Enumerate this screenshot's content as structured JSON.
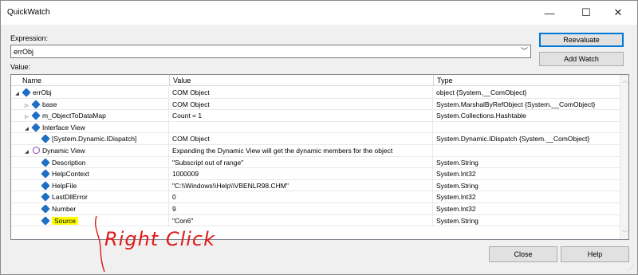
{
  "window": {
    "title": "QuickWatch",
    "minimize": "—",
    "maximize": "☐",
    "close": "✕"
  },
  "expression": {
    "label": "Expression:",
    "value": "errObj"
  },
  "value_label": "Value:",
  "buttons": {
    "reevaluate": "Reevaluate",
    "add_watch": "Add Watch",
    "close": "Close",
    "help": "Help"
  },
  "grid": {
    "columns": [
      "Name",
      "Value",
      "Type"
    ],
    "rows": [
      {
        "indent": 0,
        "expander": "◢",
        "icon": "object",
        "name": "errObj",
        "value": "COM Object",
        "type": "object {System.__ComObject}",
        "highlight": false
      },
      {
        "indent": 1,
        "expander": "▷",
        "icon": "object",
        "name": "base",
        "value": "COM Object",
        "type": "System.MarshalByRefObject {System.__ComObject}",
        "highlight": false
      },
      {
        "indent": 1,
        "expander": "▷",
        "icon": "object-private",
        "name": "m_ObjectToDataMap",
        "value": "Count = 1",
        "type": "System.Collections.Hashtable",
        "highlight": false
      },
      {
        "indent": 1,
        "expander": "◢",
        "icon": "object",
        "name": "Interface View",
        "value": "",
        "type": "",
        "highlight": false
      },
      {
        "indent": 2,
        "expander": "",
        "icon": "object",
        "name": "[System.Dynamic.IDispatch]",
        "value": "COM Object",
        "type": "System.Dynamic.IDispatch {System.__ComObject}",
        "highlight": false
      },
      {
        "indent": 1,
        "expander": "◢",
        "icon": "dynamic",
        "name": "Dynamic View",
        "value": "Expanding the Dynamic View will get the dynamic members for the object",
        "type": "",
        "highlight": false
      },
      {
        "indent": 2,
        "expander": "",
        "icon": "object",
        "name": "Description",
        "value": "\"Subscript out of range\"",
        "type": "System.String",
        "highlight": false
      },
      {
        "indent": 2,
        "expander": "",
        "icon": "object",
        "name": "HelpContext",
        "value": "1000009",
        "type": "System.Int32",
        "highlight": false
      },
      {
        "indent": 2,
        "expander": "",
        "icon": "object",
        "name": "HelpFile",
        "value": "\"C:\\\\Windows\\\\Help\\\\VBENLR98.CHM\"",
        "type": "System.String",
        "highlight": false
      },
      {
        "indent": 2,
        "expander": "",
        "icon": "object",
        "name": "LastDllError",
        "value": "0",
        "type": "System.Int32",
        "highlight": false
      },
      {
        "indent": 2,
        "expander": "",
        "icon": "object",
        "name": "Number",
        "value": "9",
        "type": "System.Int32",
        "highlight": false
      },
      {
        "indent": 2,
        "expander": "",
        "icon": "object",
        "name": "Source",
        "value": "\"Con6\"",
        "type": "System.String",
        "highlight": true
      }
    ]
  },
  "annotation": {
    "text": "Right Click",
    "color": "#e01b1b"
  },
  "colors": {
    "highlight": "#ffff00",
    "object_icon": "#1f6fc5",
    "dynamic_icon": "#8a3fb7",
    "default_button_border": "#0078d7"
  }
}
